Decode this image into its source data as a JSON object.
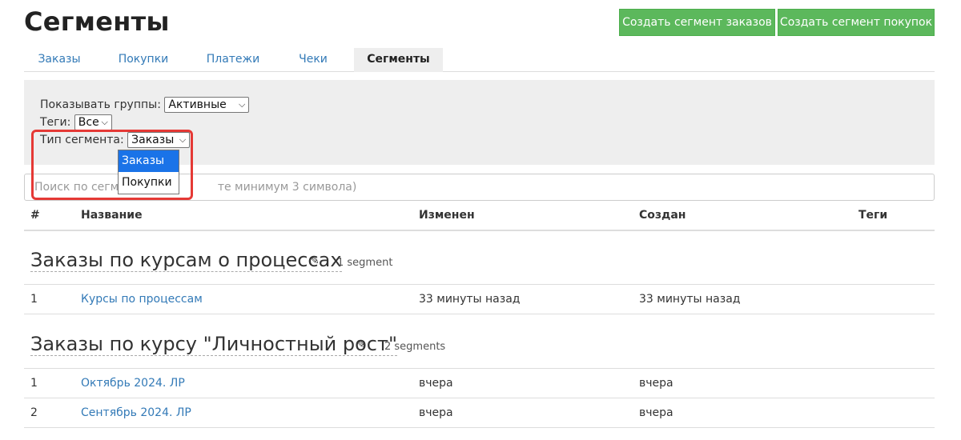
{
  "header": {
    "title": "Сегменты",
    "btn_create_orders": "Создать сегмент заказов",
    "btn_create_purchases": "Создать сегмент покупок"
  },
  "tabs": [
    {
      "label": "Заказы",
      "active": false
    },
    {
      "label": "Покупки",
      "active": false
    },
    {
      "label": "Платежи",
      "active": false
    },
    {
      "label": "Чеки",
      "active": false
    },
    {
      "label": "Сегменты",
      "active": true
    }
  ],
  "filters": {
    "groups_label": "Показывать группы:",
    "groups_value": "Активные",
    "tags_label": "Теги:",
    "tags_value": "Все",
    "type_label": "Тип сегмента:",
    "type_value": "Заказы",
    "type_options": [
      "Заказы",
      "Покупки"
    ]
  },
  "search": {
    "placeholder_left": "Поиск по сегме",
    "placeholder_right": "те минимум 3 символа)"
  },
  "table": {
    "columns": [
      "#",
      "Название",
      "Изменен",
      "Создан",
      "Теги"
    ]
  },
  "groups": [
    {
      "title": "Заказы по курсам о процессах",
      "count": "1 segment",
      "rows": [
        {
          "num": "1",
          "name": "Курсы по процессам",
          "changed": "33 минуты назад",
          "created": "33 минуты назад"
        }
      ]
    },
    {
      "title": "Заказы по курсу \"Личностный рост\"",
      "count": "2 segments",
      "rows": [
        {
          "num": "1",
          "name": "Октябрь 2024. ЛР",
          "changed": "вчера",
          "created": "вчера"
        },
        {
          "num": "2",
          "name": "Сентябрь 2024. ЛР",
          "changed": "вчера",
          "created": "вчера"
        }
      ]
    }
  ],
  "colors": {
    "accent_green": "#5cb85c",
    "link_blue": "#337ab7",
    "highlight_red": "#e53935"
  }
}
